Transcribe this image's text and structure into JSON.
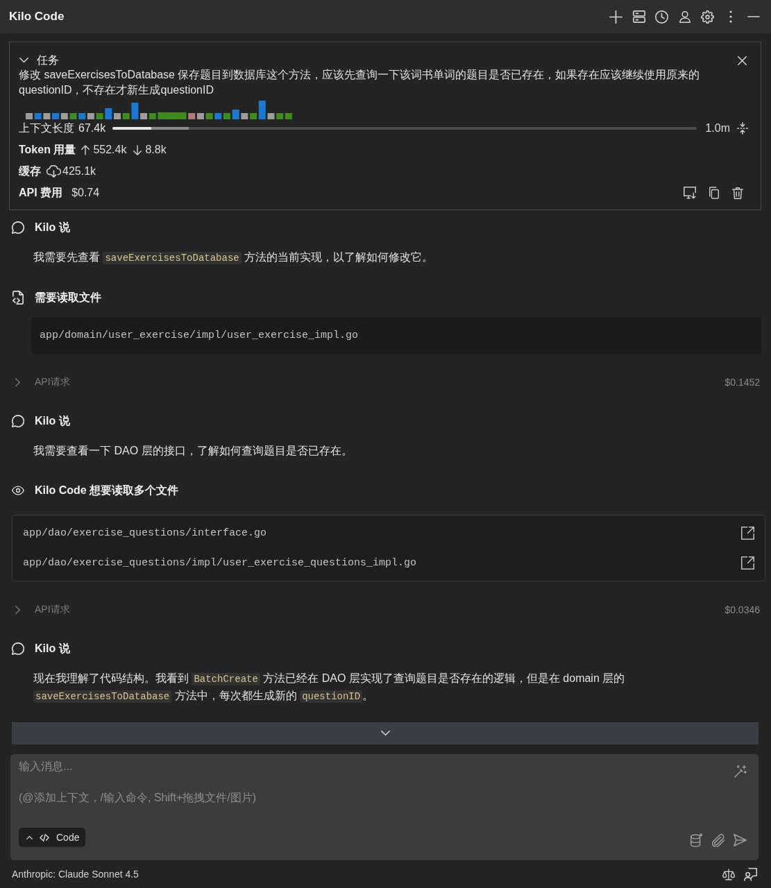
{
  "header": {
    "title": "Kilo Code"
  },
  "task": {
    "heading": "任务",
    "expanded": true,
    "description": "修改 saveExercisesToDatabase 保存题目到数据库这个方法，应该先查询一下该词书单词的题目是否已存在，如果存在应该继续使用原来的questionID，不存在才新生成questionID",
    "context": {
      "label": "上下文长度",
      "used": "67.4k",
      "limit": "1.0m",
      "segments": [
        {
          "kind": "used",
          "level": 0.066
        },
        {
          "kind": "reserved",
          "level": 0.065
        }
      ]
    },
    "tokens": {
      "label": "Token 用量",
      "input": "552.4k",
      "output": "8.8k"
    },
    "cache": {
      "label": "缓存",
      "value": "425.1k"
    },
    "cost": {
      "label": "API 费用",
      "value": "$0.74"
    }
  },
  "messages": [
    {
      "kind": "say",
      "title": "Kilo 说",
      "paragraphs": [
        [
          {
            "kind": "text",
            "text": "我需要先查看 "
          },
          {
            "kind": "code",
            "text": "saveExercisesToDatabase"
          },
          {
            "kind": "text",
            "text": " 方法的当前实现，以了解如何修改它。"
          }
        ]
      ]
    },
    {
      "kind": "read_file",
      "title": "需要读取文件",
      "path": "app/domain/user_exercise/impl/user_exercise_impl.go"
    },
    {
      "kind": "api_request",
      "title": "API请求",
      "cost": "$0.1452",
      "expanded": false
    },
    {
      "kind": "say",
      "title": "Kilo 说",
      "paragraphs": [
        [
          {
            "kind": "text",
            "text": "我需要查看一下 DAO 层的接口，了解如何查询题目是否已存在。"
          }
        ]
      ]
    },
    {
      "kind": "read_files",
      "title": "Kilo Code 想要读取多个文件",
      "files": [
        "app/dao/exercise_questions/interface.go",
        "app/dao/exercise_questions/impl/user_exercise_questions_impl.go"
      ]
    },
    {
      "kind": "api_request",
      "title": "API请求",
      "cost": "$0.0346",
      "expanded": false
    },
    {
      "kind": "say",
      "title": "Kilo 说",
      "paragraphs": [
        [
          {
            "kind": "text",
            "text": "现在我理解了代码结构。我看到 "
          },
          {
            "kind": "code",
            "text": "BatchCreate"
          },
          {
            "kind": "text",
            "text": " 方法已经在 DAO 层实现了查询题目是否存在的逻辑，但是在 domain 层的 "
          },
          {
            "kind": "code",
            "text": "saveExercisesToDatabase"
          },
          {
            "kind": "text",
            "text": " 方法中，每次都生成新的 "
          },
          {
            "kind": "code",
            "text": "questionID"
          },
          {
            "kind": "text",
            "text": "。"
          }
        ]
      ]
    }
  ],
  "composer": {
    "placeholder": "输入消息...",
    "hint": "(@添加上下文，/输入命令, Shift+拖拽文件/图片)",
    "mode": "Code"
  },
  "status_bar": {
    "model": "Anthropic: Claude Sonnet 4.5"
  }
}
